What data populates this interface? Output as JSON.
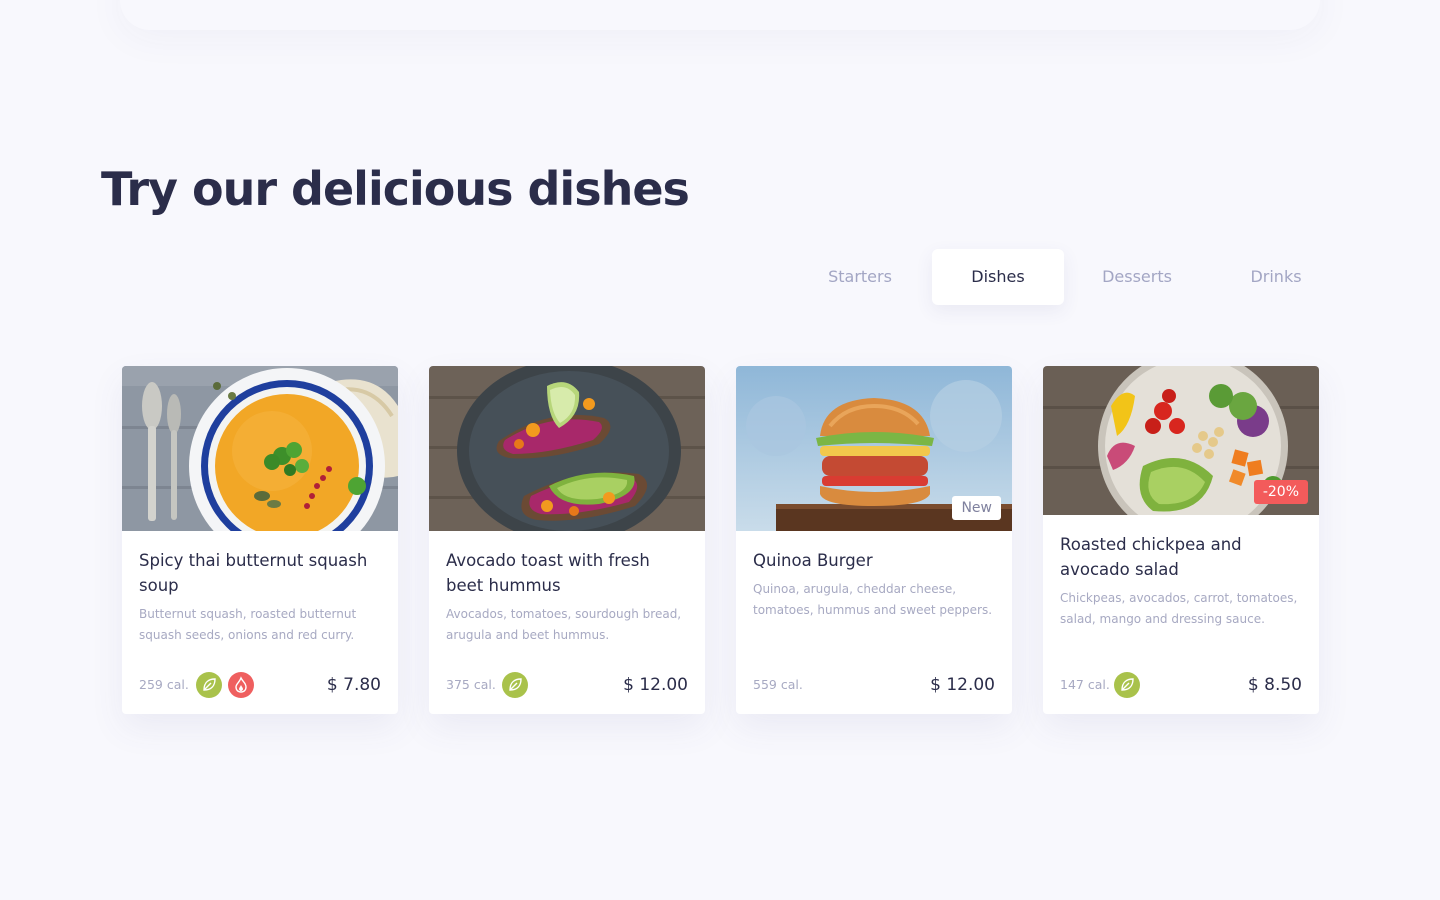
{
  "heading": "Try our delicious dishes",
  "tabs": [
    {
      "label": "Starters",
      "active": false
    },
    {
      "label": "Dishes",
      "active": true
    },
    {
      "label": "Desserts",
      "active": false
    },
    {
      "label": "Drinks",
      "active": false
    }
  ],
  "dishes": [
    {
      "name": "Spicy thai butternut squash soup",
      "description": "Butternut squash, roasted butternut squash seeds, onions and red curry.",
      "calories": "259 cal.",
      "icons": [
        "vegetarian-leaf-icon",
        "spicy-flame-icon"
      ],
      "price": "$ 7.80",
      "badge": ""
    },
    {
      "name": "Avocado toast with fresh beet hummus",
      "description": "Avocados, tomatoes, sourdough bread, arugula and beet hummus.",
      "calories": "375 cal.",
      "icons": [
        "vegetarian-leaf-icon"
      ],
      "price": "$ 12.00",
      "badge": ""
    },
    {
      "name": "Quinoa Burger",
      "description": "Quinoa, arugula, cheddar cheese, tomatoes, hummus and sweet peppers.",
      "calories": "559 cal.",
      "icons": [],
      "price": "$ 12.00",
      "badge": "New"
    },
    {
      "name": "Roasted chickpea and avocado salad",
      "description": "Chickpeas, avocados, carrot, tomatoes, salad, mango and dressing sauce.",
      "calories": "147 cal.",
      "icons": [
        "vegetarian-leaf-icon"
      ],
      "price": "$ 8.50",
      "badge": "-20%"
    }
  ],
  "colors": {
    "background": "#f8f8fd",
    "heading": "#2b2d4a",
    "muted": "#a7a9c2",
    "vegetarian": "#a9c24b",
    "spicy": "#ef5f5f",
    "sale": "#f35b5b"
  }
}
